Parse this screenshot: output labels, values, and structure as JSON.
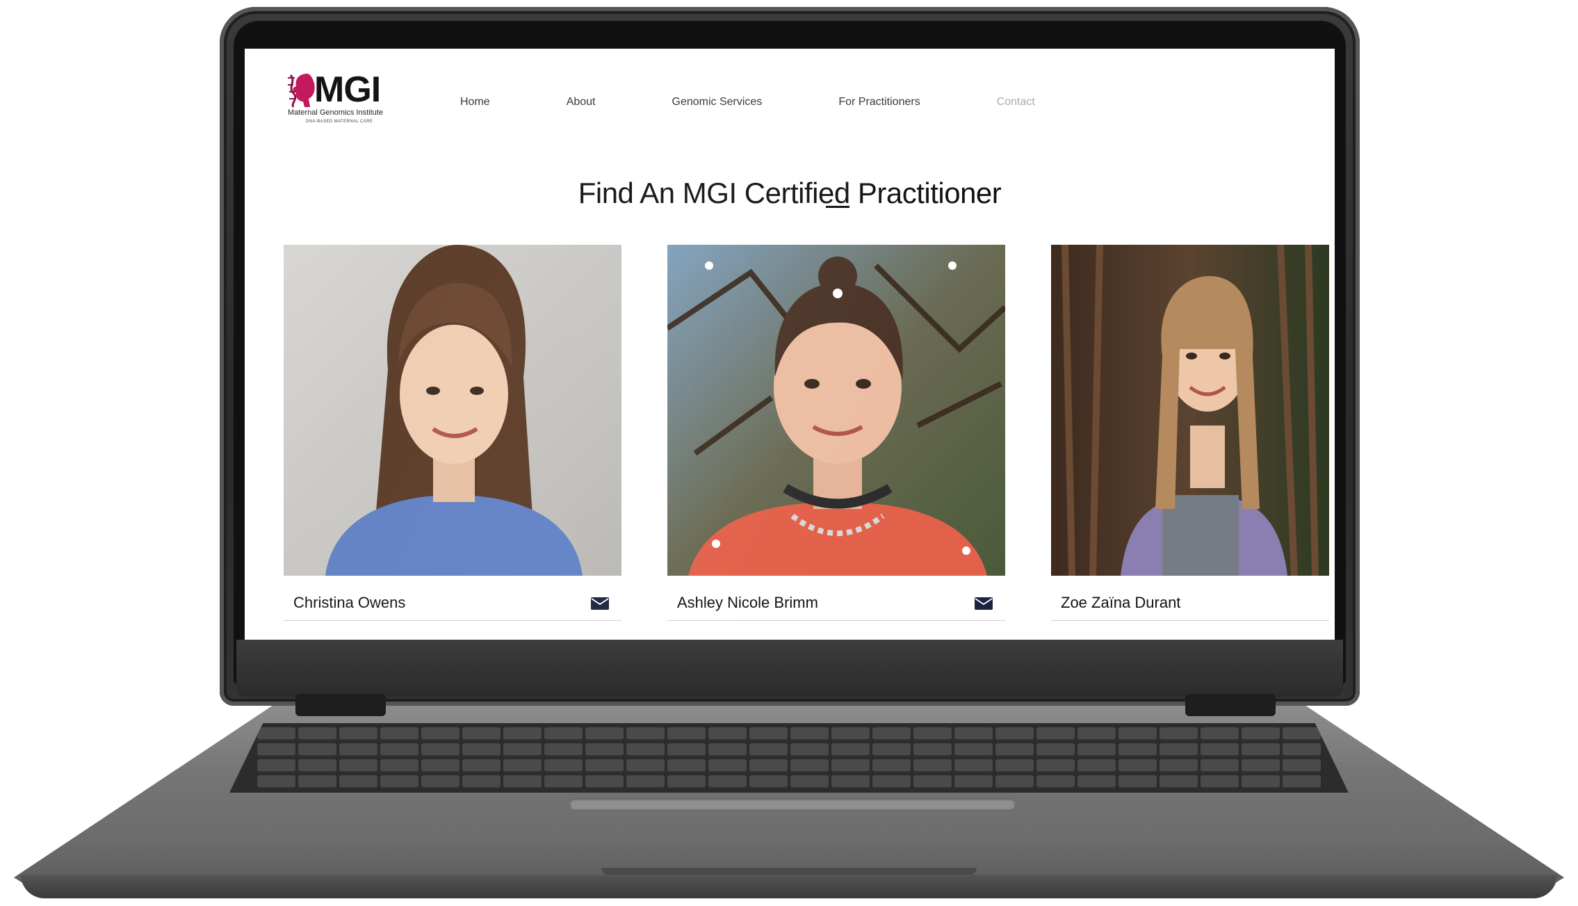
{
  "logo": {
    "mark": "MGI",
    "subtitle": "Maternal Genomics Institute",
    "tagline": "DNA-BASED MATERNAL CARE"
  },
  "nav": {
    "items": [
      {
        "label": "Home"
      },
      {
        "label": "About"
      },
      {
        "label": "Genomic Services"
      },
      {
        "label": "For Practitioners"
      },
      {
        "label": "Contact"
      }
    ]
  },
  "page": {
    "title": "Find An MGI Certified Practitioner"
  },
  "practitioners": [
    {
      "name": "Christina Owens",
      "icon": "envelope-icon"
    },
    {
      "name": "Ashley Nicole Brimm",
      "icon": "envelope-icon"
    },
    {
      "name": "Zoe Zaïna Durant"
    }
  ],
  "colors": {
    "brand_accent": "#c2185b",
    "text": "#111111",
    "muted_nav": "#aaaaaa",
    "laptop_frame": "#2a2a2a"
  }
}
